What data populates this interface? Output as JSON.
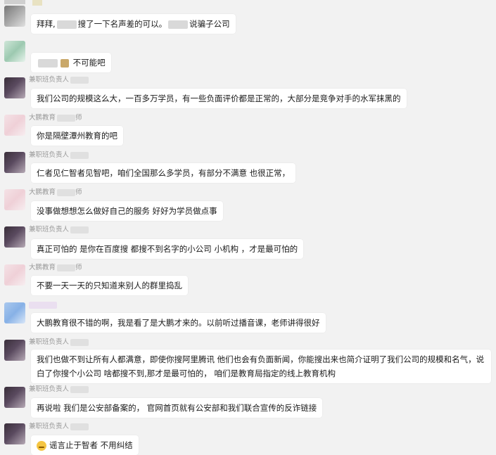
{
  "messages": [
    {
      "id": "m1",
      "avatar": "gray",
      "sender": "",
      "parts": [
        "拜拜,",
        "搜了一下名声差的可以。",
        "说骗子公司"
      ]
    },
    {
      "id": "m2",
      "avatar": "green",
      "sender": "",
      "text": "不可能吧"
    },
    {
      "id": "m3",
      "avatar": "dark",
      "sender": "兼职班负责人",
      "text": "我们公司的规模这么大，一百多万学员，有一些负面评价都是正常的，大部分是竞争对手的水军抹黑的"
    },
    {
      "id": "m4",
      "avatar": "pink",
      "sender": "大鹏教育",
      "sender_suffix": "师",
      "text": "你是隔壁潭州教育的吧"
    },
    {
      "id": "m5",
      "avatar": "dark",
      "sender": "兼职班负责人",
      "text": "仁者见仁智者见智吧，咱们全国那么多学员，有部分不满意 也很正常，"
    },
    {
      "id": "m6",
      "avatar": "pink",
      "sender": "大鹏教育",
      "sender_suffix": "师",
      "text": "没事做想想怎么做好自己的服务 好好为学员做点事"
    },
    {
      "id": "m7",
      "avatar": "dark",
      "sender": "兼职班负责人",
      "text": "真正可怕的 是你在百度搜 都搜不到名字的小公司 小机构 ，才是最可怕的"
    },
    {
      "id": "m8",
      "avatar": "pink",
      "sender": "大鹏教育",
      "sender_suffix": "师",
      "text": "不要一天一天的只知道来别人的群里捣乱"
    },
    {
      "id": "m9",
      "avatar": "blue",
      "sender": "",
      "text": "大鹏教育很不错的啊，我是看了是大鹏才来的。以前听过播音课，老师讲得很好"
    },
    {
      "id": "m10",
      "avatar": "dark",
      "sender": "兼职班负责人",
      "text": "我们也做不到让所有人都满意，即使你搜阿里腾讯 他们也会有负面新闻，你能搜出来也简介证明了我们公司的规模和名气，说白了你搜个小公司 啥都搜不到,那才是最可怕的，  咱们是教育局指定的线上教育机构"
    },
    {
      "id": "m11",
      "avatar": "dark",
      "sender": "兼职班负责人",
      "text": "再说啦 我们是公安部备案的，  官网首页就有公安部和我们联合宣传的反诈链接"
    },
    {
      "id": "m12",
      "avatar": "dark",
      "sender": "兼职班负责人",
      "emoji": "smiling-face",
      "text": "谣言止于智者 不用纠结"
    }
  ]
}
